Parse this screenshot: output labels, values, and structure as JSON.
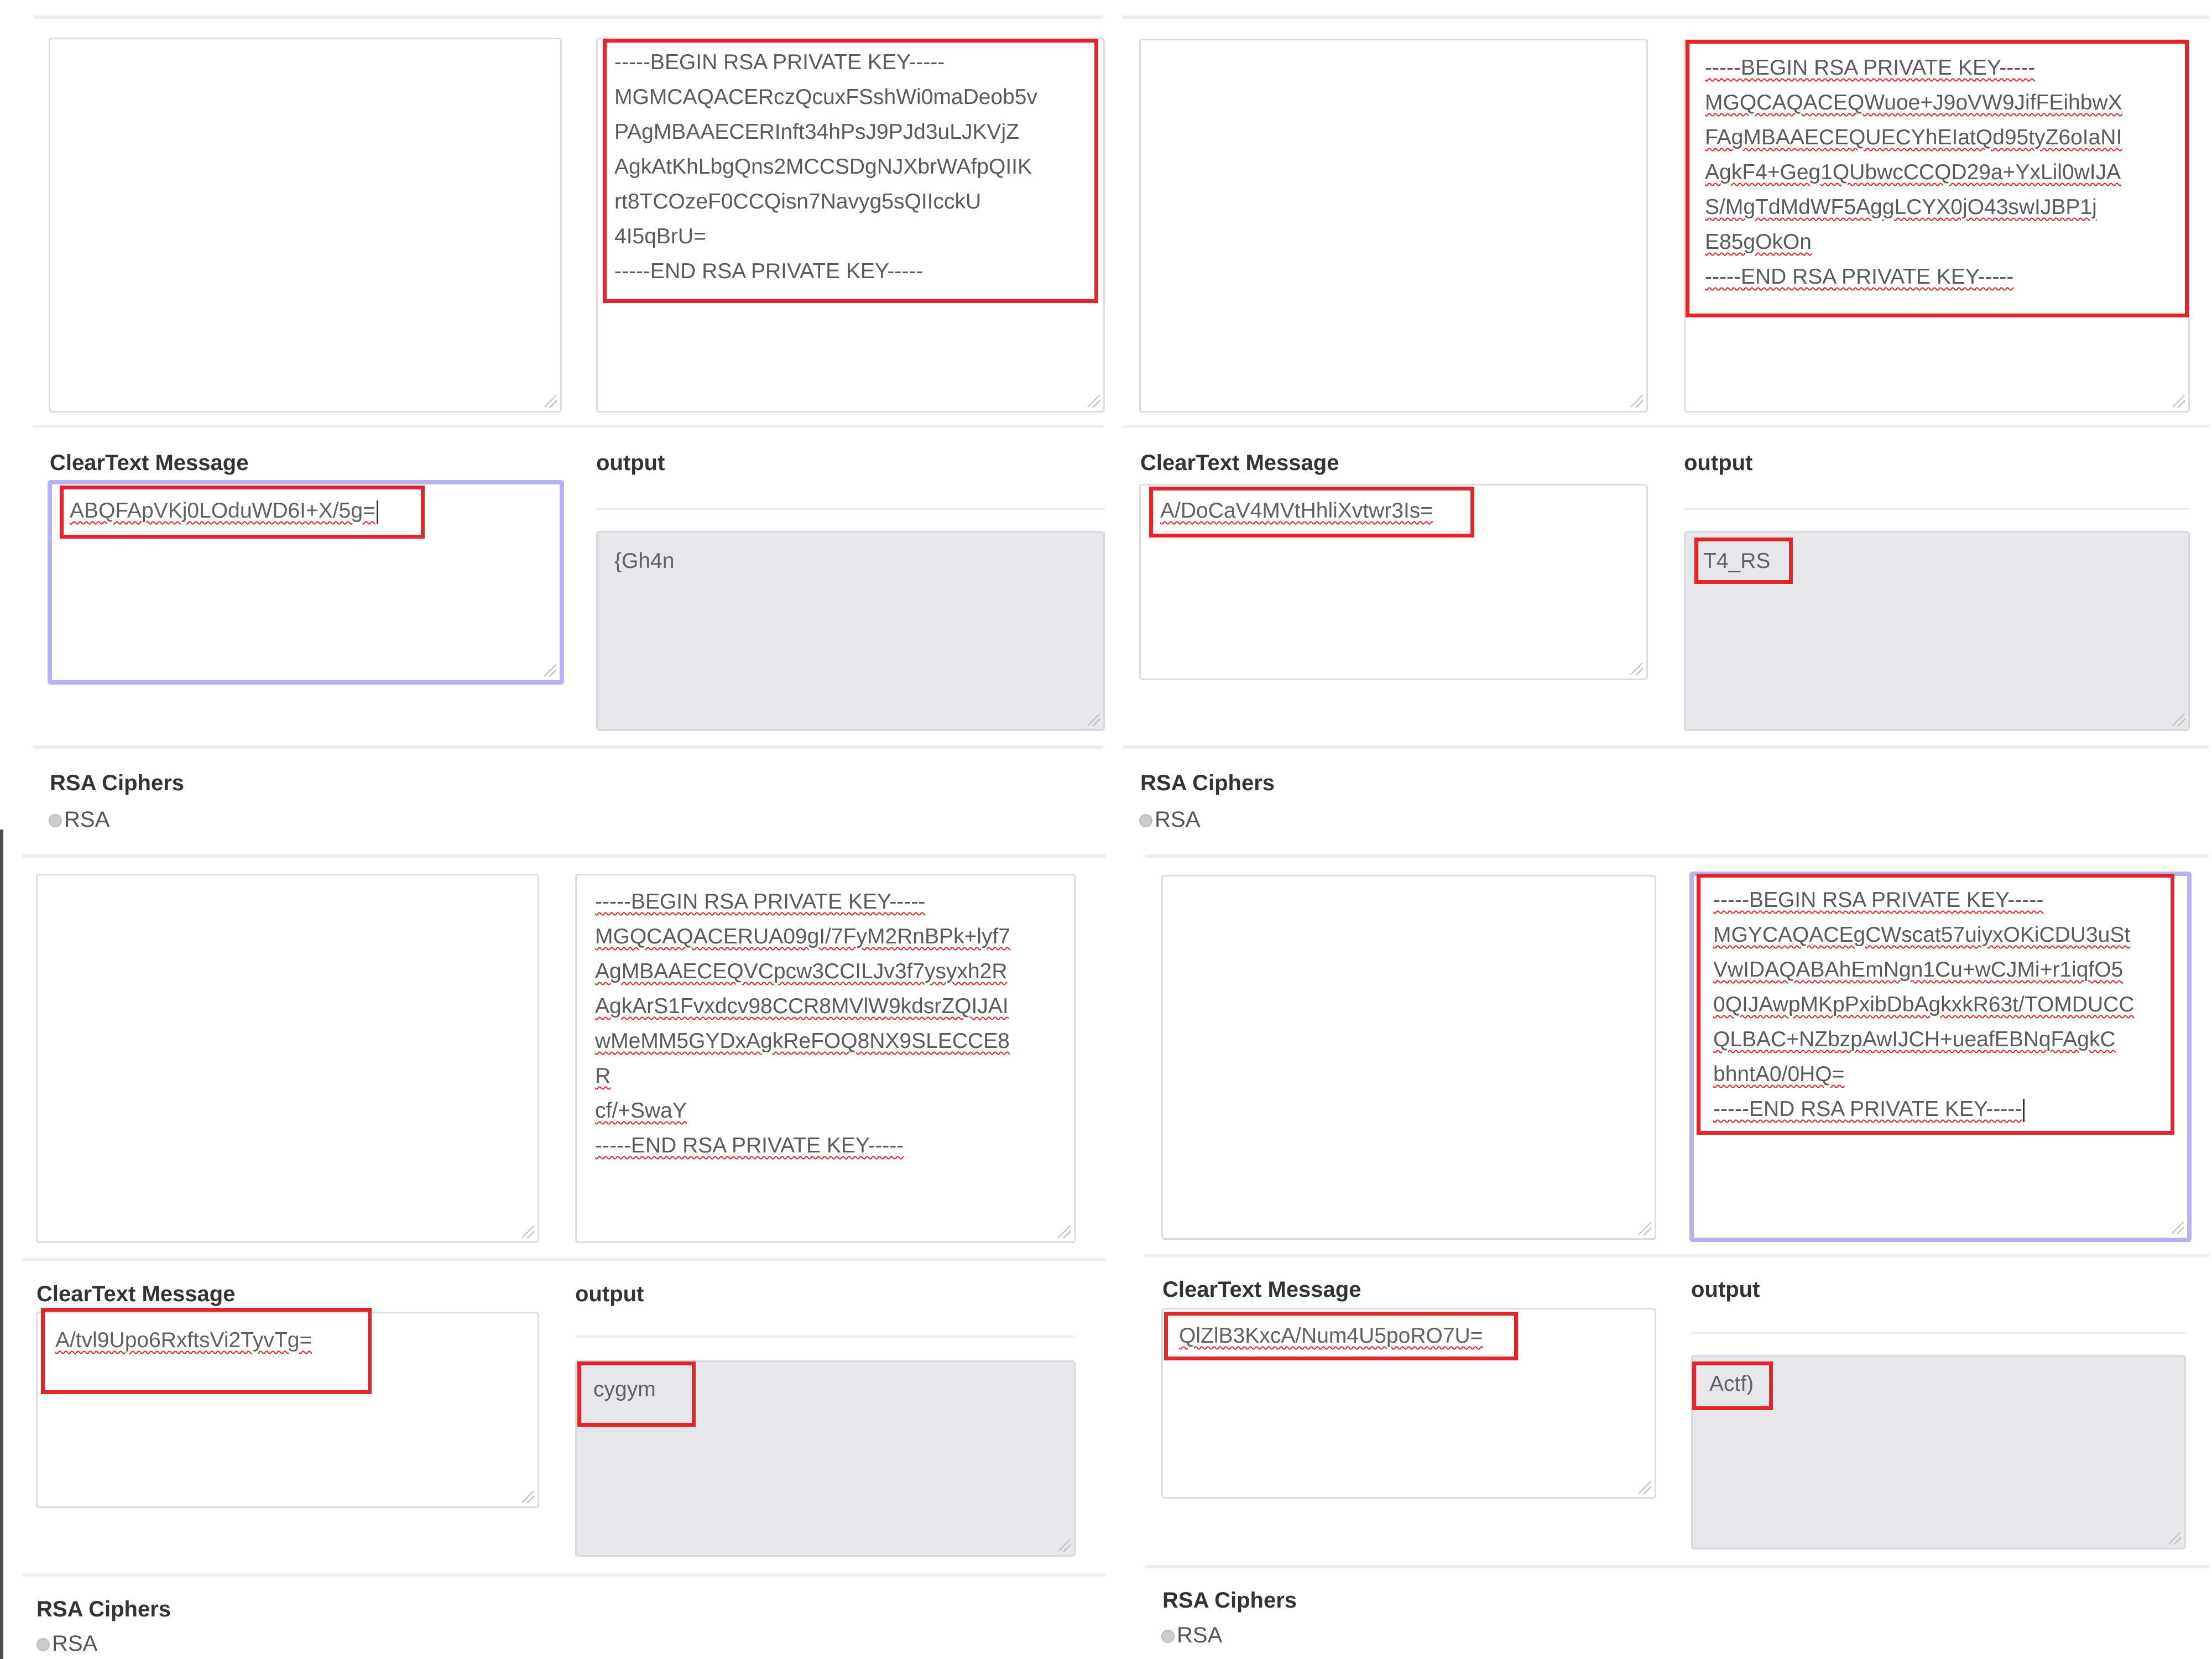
{
  "panels": [
    {
      "private_key_lines": [
        "-----BEGIN RSA PRIVATE KEY-----",
        "MGMCAQACERczQcuxFSshWi0maDeob5v",
        "PAgMBAAECERInft34hPsJ9PJd3uLJKVjZ",
        "AgkAtKhLbgQns2MCCSDgNJXbrWAfpQIIK",
        "rt8TCOzeF0CCQisn7Navyg5sQIIcckU",
        "4I5qBrU=",
        "-----END RSA PRIVATE KEY-----"
      ],
      "cleartext_label": "ClearText Message",
      "cleartext_value": "ABQFApVKj0LOduWD6I+X/5g=",
      "output_label": "output",
      "output_value": "{Gh4n",
      "ciphers_label": "RSA Ciphers",
      "radio_label": "RSA"
    },
    {
      "private_key_lines": [
        "-----BEGIN RSA PRIVATE KEY-----",
        "MGQCAQACEQWuoe+J9oVW9JifFEihbwX",
        "FAgMBAAECEQUECYhEIatQd95tyZ6oIaNI",
        "AgkF4+Geg1QUbwcCCQD29a+YxLil0wIJA",
        "S/MgTdMdWF5AggLCYX0jO43swIJBP1j",
        "E85gOkOn",
        "-----END RSA PRIVATE KEY-----"
      ],
      "cleartext_label": "ClearText Message",
      "cleartext_value": "A/DoCaV4MVtHhliXvtwr3Is=",
      "output_label": "output",
      "output_value": "T4_RS",
      "ciphers_label": "RSA Ciphers",
      "radio_label": "RSA"
    },
    {
      "private_key_lines": [
        "-----BEGIN RSA PRIVATE KEY-----",
        "MGQCAQACERUA09gI/7FyM2RnBPk+lyf7",
        "AgMBAAECEQVCpcw3CCILJv3f7ysyxh2R",
        "AgkArS1Fvxdcv98CCR8MVlW9kdsrZQIJAI",
        "wMeMM5GYDxAgkReFOQ8NX9SLECCE8",
        "R",
        "cf/+SwaY",
        "-----END RSA PRIVATE KEY-----"
      ],
      "cleartext_label": "ClearText Message",
      "cleartext_value": "A/tvl9Upo6RxftsVi2TyvTg=",
      "output_label": "output",
      "output_value": "cygym",
      "ciphers_label": "RSA Ciphers",
      "radio_label": "RSA"
    },
    {
      "private_key_lines": [
        "-----BEGIN RSA PRIVATE KEY-----",
        "MGYCAQACEgCWscat57uiyxOKiCDU3uSt",
        "VwIDAQABAhEmNgn1Cu+wCJMi+r1iqfO5",
        "0QIJAwpMKpPxibDbAgkxkR63t/TOMDUCC",
        "QLBAC+NZbzpAwIJCH+ueafEBNqFAgkC",
        "bhntA0/0HQ=",
        "-----END RSA PRIVATE KEY-----"
      ],
      "cleartext_label": "ClearText Message",
      "cleartext_value": "QlZlB3KxcA/Num4U5poRO7U=",
      "output_label": "output",
      "output_value": "Actf)",
      "ciphers_label": "RSA Ciphers",
      "radio_label": "RSA"
    }
  ]
}
